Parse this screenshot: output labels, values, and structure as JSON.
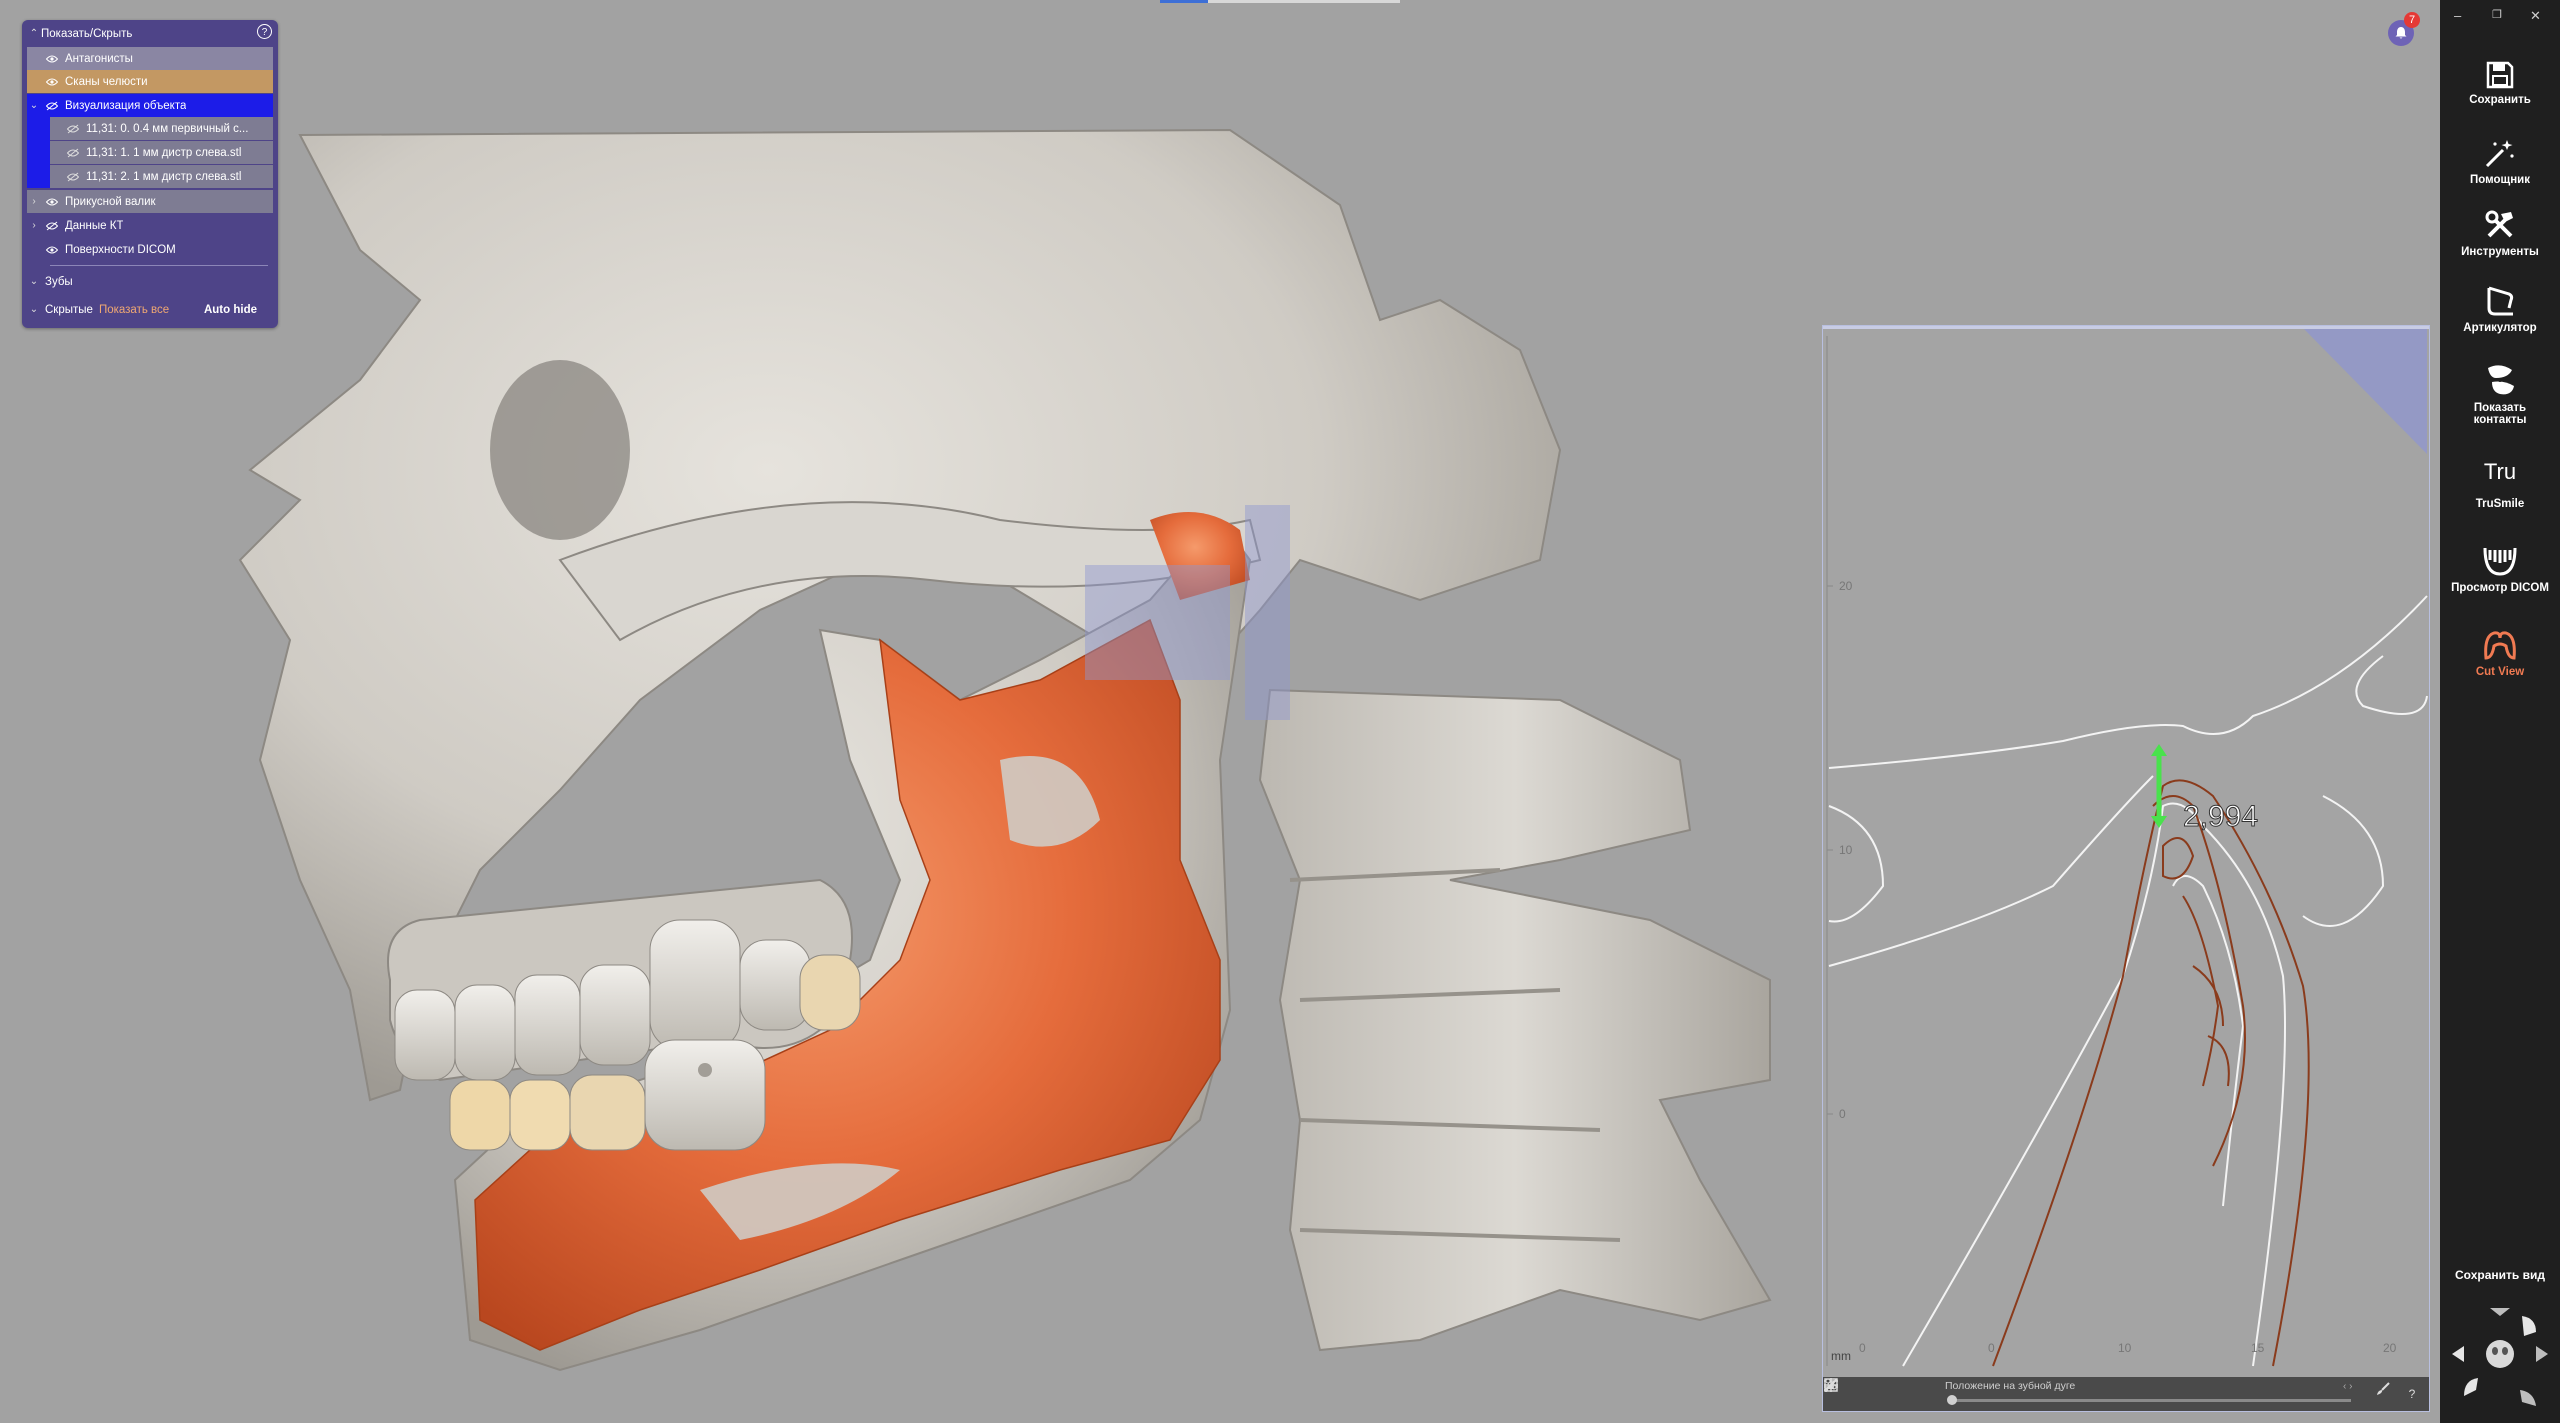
{
  "panel": {
    "header": "Показать/Скрыть",
    "rows": [
      {
        "label": "Антагонисты"
      },
      {
        "label": "Сканы челюсти"
      },
      {
        "label": "Визуализация объекта"
      },
      {
        "label": "11,31: 0. 0.4 мм первичный с..."
      },
      {
        "label": "11,31: 1. 1 мм дистр слева.stl"
      },
      {
        "label": "11,31: 2. 1 мм дистр слева.stl"
      },
      {
        "label": "Прикусной валик"
      },
      {
        "label": "Данные КТ"
      },
      {
        "label": "Поверхности DICOM"
      }
    ],
    "teeth": "Зубы",
    "hidden": "Скрытые",
    "show_all": "Показать все",
    "auto_hide": "Auto hide"
  },
  "notification": {
    "count": "7"
  },
  "cutview": {
    "measurement": "2,994",
    "unit": "mm",
    "y_ticks": [
      "20",
      "10",
      "0"
    ],
    "x_ticks": [
      "0",
      "0",
      "10",
      "15",
      "20"
    ],
    "slider_label": "Положение на зубной дуге",
    "help": "?"
  },
  "sidebar": {
    "items": [
      {
        "label": "Сохранить"
      },
      {
        "label": "Помощник"
      },
      {
        "label": "Инструменты"
      },
      {
        "label": "Артикулятор"
      },
      {
        "label": "Показать контакты"
      },
      {
        "label": "TruSmile"
      },
      {
        "label": "Просмотр DICOM"
      },
      {
        "label": "Cut View"
      }
    ],
    "tru_glyph": "Tru",
    "save_view": "Сохранить вид"
  },
  "colors": {
    "accent": "#f07a52",
    "panel": "#4e4488",
    "bone": "#d8d5cf",
    "graft": "#e2683a"
  }
}
